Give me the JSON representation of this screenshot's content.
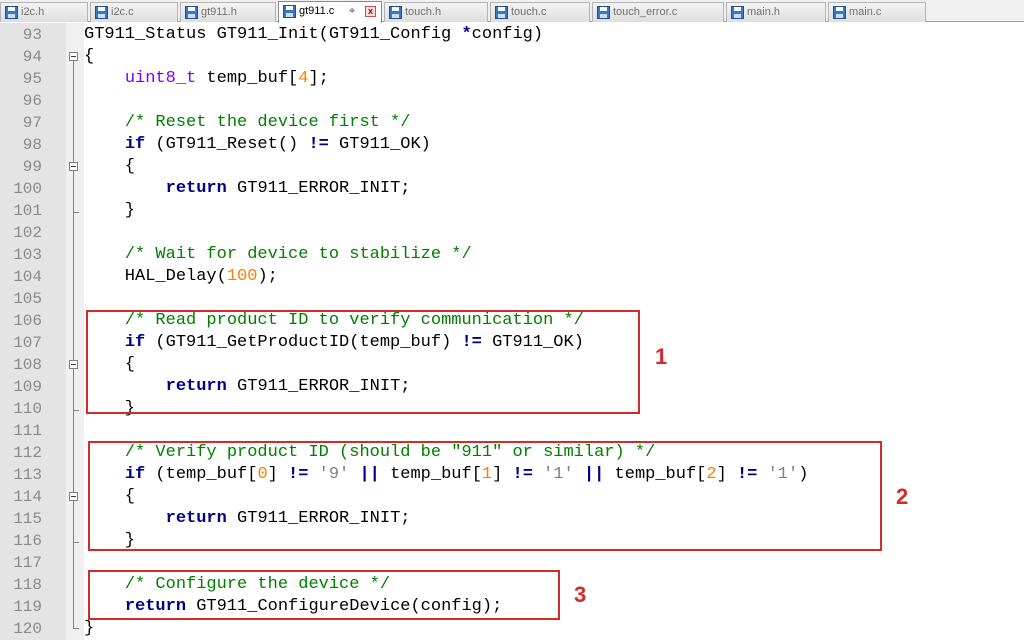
{
  "tabs": [
    {
      "label": "i2c.h",
      "active": false
    },
    {
      "label": "i2c.c",
      "active": false
    },
    {
      "label": "gt911.h",
      "active": false
    },
    {
      "label": "gt911.c",
      "active": true
    },
    {
      "label": "touch.h",
      "active": false
    },
    {
      "label": "touch.c",
      "active": false
    },
    {
      "label": "touch_error.c",
      "active": false
    },
    {
      "label": "main.h",
      "active": false
    },
    {
      "label": "main.c",
      "active": false
    }
  ],
  "icons": {
    "file": "file-save-icon",
    "pin": "pin-icon",
    "close": "close-tab-icon",
    "fold": "fold-toggle-icon"
  },
  "colors": {
    "keyword": "#00008b",
    "type": "#8000ff",
    "comment": "#008000",
    "number": "#ff8000",
    "string": "#808080",
    "highlight": "#d42a2a"
  },
  "lines": [
    {
      "n": "93",
      "tokens": [
        {
          "t": "GT911_Status GT911_Init(GT911_Config "
        },
        {
          "t": "*",
          "c": "kw"
        },
        {
          "t": "config)"
        }
      ]
    },
    {
      "n": "94",
      "tokens": [
        {
          "t": "{"
        }
      ]
    },
    {
      "n": "95",
      "tokens": [
        {
          "t": "    "
        },
        {
          "t": "uint8_t",
          "c": "ty"
        },
        {
          "t": " temp_buf["
        },
        {
          "t": "4",
          "c": "nm"
        },
        {
          "t": "];"
        }
      ]
    },
    {
      "n": "96",
      "tokens": []
    },
    {
      "n": "97",
      "tokens": [
        {
          "t": "    "
        },
        {
          "t": "/* Reset the device first */",
          "c": "cm"
        }
      ]
    },
    {
      "n": "98",
      "tokens": [
        {
          "t": "    "
        },
        {
          "t": "if",
          "c": "kw"
        },
        {
          "t": " (GT911_Reset() "
        },
        {
          "t": "!=",
          "c": "kw"
        },
        {
          "t": " GT911_OK)"
        }
      ]
    },
    {
      "n": "99",
      "tokens": [
        {
          "t": "    {"
        }
      ]
    },
    {
      "n": "100",
      "tokens": [
        {
          "t": "        "
        },
        {
          "t": "return",
          "c": "kw"
        },
        {
          "t": " GT911_ERROR_INIT;"
        }
      ]
    },
    {
      "n": "101",
      "tokens": [
        {
          "t": "    }"
        }
      ]
    },
    {
      "n": "102",
      "tokens": []
    },
    {
      "n": "103",
      "tokens": [
        {
          "t": "    "
        },
        {
          "t": "/* Wait for device to stabilize */",
          "c": "cm"
        }
      ]
    },
    {
      "n": "104",
      "tokens": [
        {
          "t": "    HAL_Delay("
        },
        {
          "t": "100",
          "c": "nm"
        },
        {
          "t": ");"
        }
      ]
    },
    {
      "n": "105",
      "tokens": []
    },
    {
      "n": "106",
      "tokens": [
        {
          "t": "    "
        },
        {
          "t": "/* Read product ID to verify communication */",
          "c": "cm"
        }
      ]
    },
    {
      "n": "107",
      "tokens": [
        {
          "t": "    "
        },
        {
          "t": "if",
          "c": "kw"
        },
        {
          "t": " (GT911_GetProductID(temp_buf) "
        },
        {
          "t": "!=",
          "c": "kw"
        },
        {
          "t": " GT911_OK)"
        }
      ]
    },
    {
      "n": "108",
      "tokens": [
        {
          "t": "    {"
        }
      ]
    },
    {
      "n": "109",
      "tokens": [
        {
          "t": "        "
        },
        {
          "t": "return",
          "c": "kw"
        },
        {
          "t": " GT911_ERROR_INIT;"
        }
      ]
    },
    {
      "n": "110",
      "tokens": [
        {
          "t": "    }"
        }
      ]
    },
    {
      "n": "111",
      "tokens": []
    },
    {
      "n": "112",
      "tokens": [
        {
          "t": "    "
        },
        {
          "t": "/* Verify product ID (should be \"911\" or similar) */",
          "c": "cm"
        }
      ]
    },
    {
      "n": "113",
      "tokens": [
        {
          "t": "    "
        },
        {
          "t": "if",
          "c": "kw"
        },
        {
          "t": " (temp_buf["
        },
        {
          "t": "0",
          "c": "nm"
        },
        {
          "t": "] "
        },
        {
          "t": "!=",
          "c": "kw"
        },
        {
          "t": " "
        },
        {
          "t": "'9'",
          "c": "st"
        },
        {
          "t": " "
        },
        {
          "t": "||",
          "c": "kw"
        },
        {
          "t": " temp_buf["
        },
        {
          "t": "1",
          "c": "nm"
        },
        {
          "t": "] "
        },
        {
          "t": "!=",
          "c": "kw"
        },
        {
          "t": " "
        },
        {
          "t": "'1'",
          "c": "st"
        },
        {
          "t": " "
        },
        {
          "t": "||",
          "c": "kw"
        },
        {
          "t": " temp_buf["
        },
        {
          "t": "2",
          "c": "nm"
        },
        {
          "t": "] "
        },
        {
          "t": "!=",
          "c": "kw"
        },
        {
          "t": " "
        },
        {
          "t": "'1'",
          "c": "st"
        },
        {
          "t": ")"
        }
      ]
    },
    {
      "n": "114",
      "tokens": [
        {
          "t": "    {"
        }
      ]
    },
    {
      "n": "115",
      "tokens": [
        {
          "t": "        "
        },
        {
          "t": "return",
          "c": "kw"
        },
        {
          "t": " GT911_ERROR_INIT;"
        }
      ]
    },
    {
      "n": "116",
      "tokens": [
        {
          "t": "    }"
        }
      ]
    },
    {
      "n": "117",
      "tokens": []
    },
    {
      "n": "118",
      "tokens": [
        {
          "t": "    "
        },
        {
          "t": "/* Configure the device */",
          "c": "cm"
        }
      ]
    },
    {
      "n": "119",
      "tokens": [
        {
          "t": "    "
        },
        {
          "t": "return",
          "c": "kw"
        },
        {
          "t": " GT911_ConfigureDevice(config);"
        }
      ]
    },
    {
      "n": "120",
      "tokens": [
        {
          "t": "}"
        }
      ]
    }
  ],
  "annotations": [
    {
      "label": "1"
    },
    {
      "label": "2"
    },
    {
      "label": "3"
    }
  ]
}
